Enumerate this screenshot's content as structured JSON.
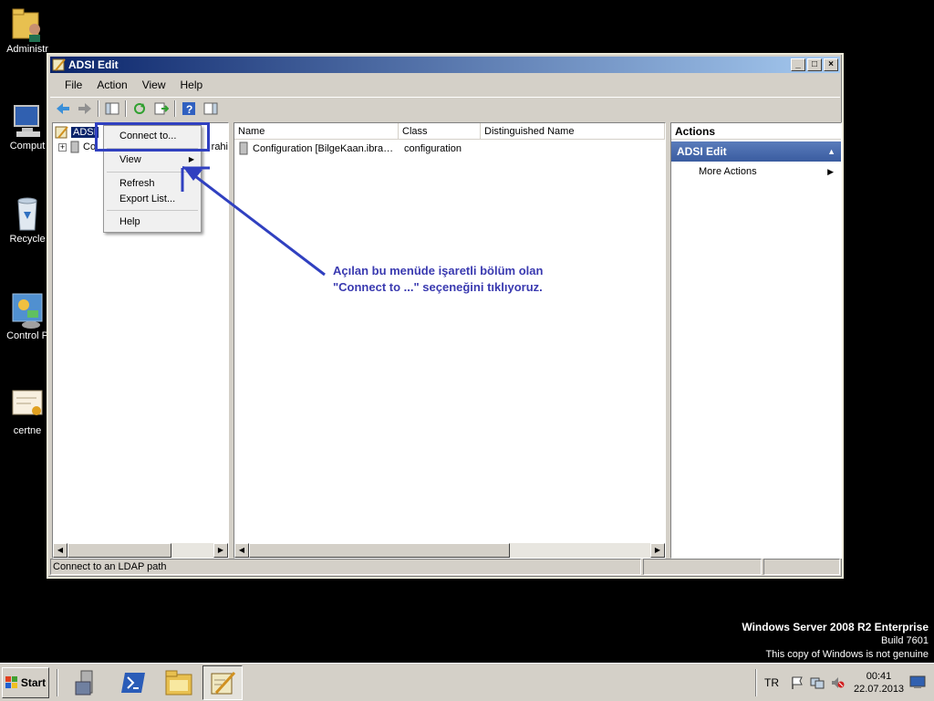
{
  "desktop": {
    "icons": [
      {
        "label": "Administr",
        "icon": "user-folder-icon"
      },
      {
        "label": "Comput",
        "icon": "computer-icon"
      },
      {
        "label": "Recycle",
        "icon": "recycle-bin-icon"
      },
      {
        "label": "Control P",
        "icon": "control-panel-icon"
      },
      {
        "label": "certne",
        "icon": "certificate-icon"
      }
    ]
  },
  "window": {
    "title": "ADSI Edit",
    "menu": [
      "File",
      "Action",
      "View",
      "Help"
    ],
    "tree": {
      "root_label": "ADSI",
      "child_label_fragment": "Co",
      "child_label_tail": "rahi"
    },
    "list": {
      "columns": [
        "Name",
        "Class",
        "Distinguished Name"
      ],
      "rows": [
        {
          "name": "Configuration [BilgeKaan.ibra…",
          "class": "configuration",
          "dn": ""
        }
      ]
    },
    "actions": {
      "header": "Actions",
      "section": "ADSI Edit",
      "items": [
        "More Actions"
      ]
    },
    "status": "Connect to an LDAP path"
  },
  "context_menu": {
    "items": [
      "Connect to...",
      "View",
      "Refresh",
      "Export List...",
      "Help"
    ]
  },
  "annotation": {
    "line1": "Açılan bu menüde işaretli bölüm olan",
    "line2": "\"Connect to ...\" seçeneğini tıklıyoruz."
  },
  "os_watermark": {
    "edition": "Windows Server 2008 R2 Enterprise",
    "build": "Build 7601",
    "notice": "This copy of Windows is not genuine"
  },
  "taskbar": {
    "start_label": "Start",
    "language": "TR",
    "time": "00:41",
    "date": "22.07.2013"
  },
  "colors": {
    "annotation": "#3a3ab0",
    "highlight_box": "#3040c0",
    "titlebar_start": "#0a246a"
  }
}
